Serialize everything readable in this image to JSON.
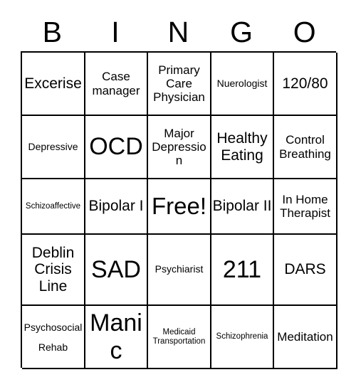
{
  "card": {
    "title": "Bingo Card",
    "header_letters": [
      "B",
      "I",
      "N",
      "G",
      "O"
    ],
    "grid_columns": 5,
    "grid_rows": 5,
    "colors": {
      "background": "#ffffff",
      "text": "#000000",
      "border": "#000000"
    },
    "rows": [
      [
        {
          "label": "Excerise",
          "size": "fs-l"
        },
        {
          "label": "Case manager",
          "size": "fs-m"
        },
        {
          "label": "Primary Care Physician",
          "size": "fs-m"
        },
        {
          "label": "Nuerologist",
          "size": "fs-s"
        },
        {
          "label": "120/80",
          "size": "fs-l"
        }
      ],
      [
        {
          "label": "Depressive",
          "size": "fs-s"
        },
        {
          "label": "OCD",
          "size": "fs-xxl"
        },
        {
          "label": "Major Depression",
          "size": "fs-m"
        },
        {
          "label": "Healthy Eating",
          "size": "fs-l"
        },
        {
          "label": "Control Breathing",
          "size": "fs-m"
        }
      ],
      [
        {
          "label": "Schizoaffective",
          "size": "fs-xs"
        },
        {
          "label": "Bipolar I",
          "size": "fs-l"
        },
        {
          "label": "Free!",
          "size": "fs-free"
        },
        {
          "label": "Bipolar II",
          "size": "fs-l"
        },
        {
          "label": "In Home Therapist",
          "size": "fs-m"
        }
      ],
      [
        {
          "label": "Deblin Crisis Line",
          "size": "fs-l"
        },
        {
          "label": "SAD",
          "size": "fs-xxl"
        },
        {
          "label": "Psychiarist",
          "size": "fs-s"
        },
        {
          "label": "211",
          "size": "fs-xxl"
        },
        {
          "label": "DARS",
          "size": "fs-l"
        }
      ],
      [
        {
          "label": "Psychosocial Rehab",
          "size": "fs-s"
        },
        {
          "label": "Manic",
          "size": "fs-xxl"
        },
        {
          "label": "Medicaid Transportation",
          "size": "fs-xs"
        },
        {
          "label": "Schizophrenia",
          "size": "fs-xs"
        },
        {
          "label": "Meditation",
          "size": "fs-m"
        }
      ]
    ]
  }
}
